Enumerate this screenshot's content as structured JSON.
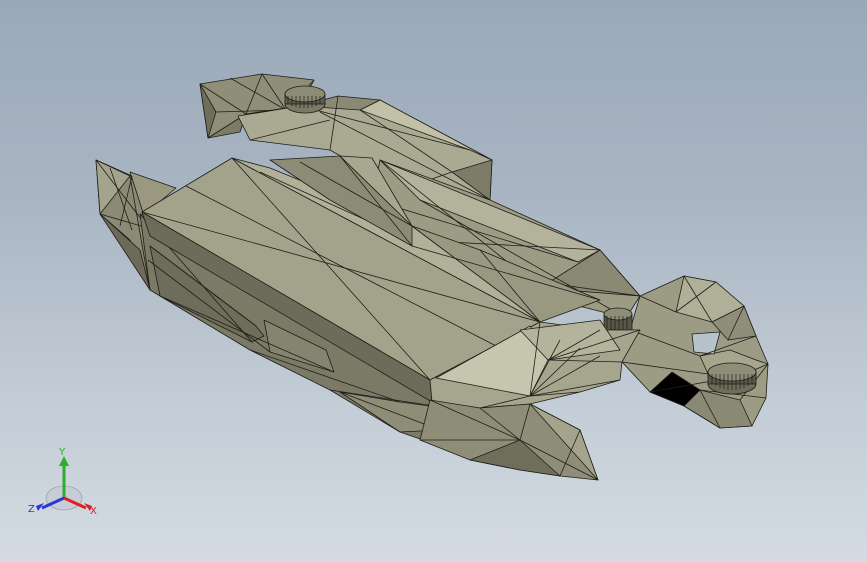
{
  "triad": {
    "x_label": "X",
    "y_label": "Y",
    "z_label": "Z",
    "x_color": "#e02020",
    "y_color": "#2cae2c",
    "z_color": "#2838d8"
  },
  "model": {
    "name": "faceted-hull-model",
    "face_color": "#9c9b83",
    "edge_color": "#1e1e18"
  }
}
